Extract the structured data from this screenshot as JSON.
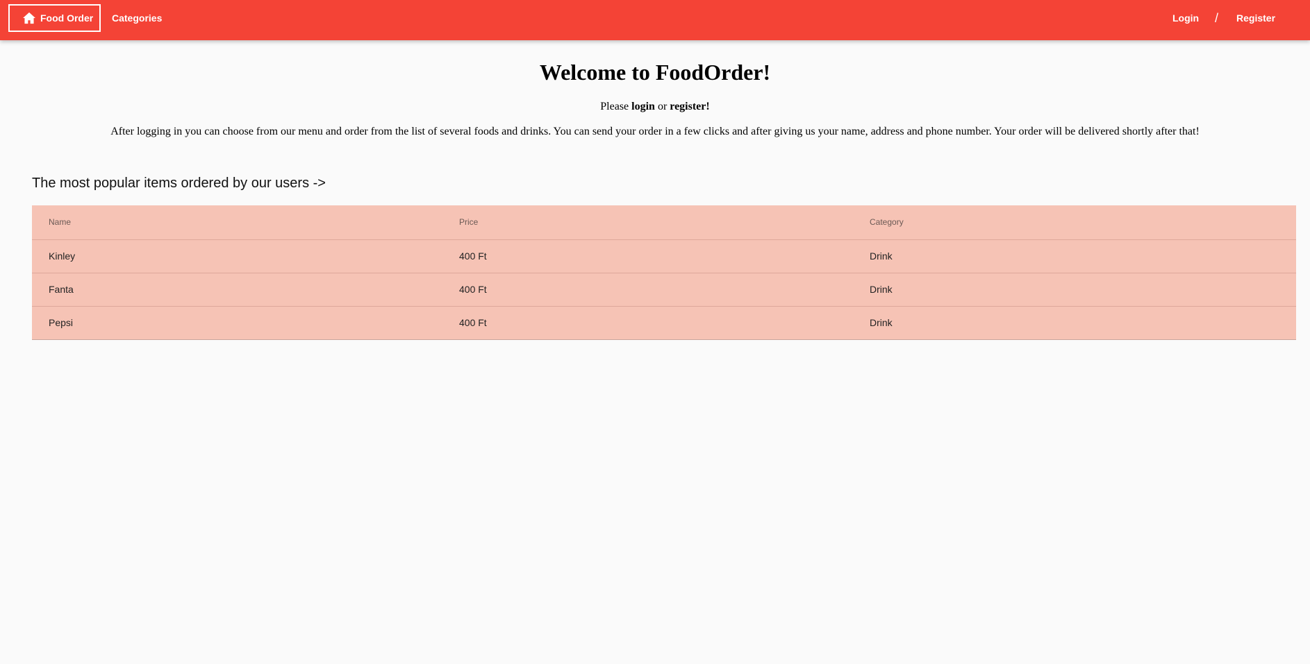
{
  "navbar": {
    "home_label": "Food Order",
    "home_icon": "home-icon",
    "categories_label": "Categories",
    "login_label": "Login",
    "separator": "/",
    "register_label": "Register",
    "color": "#f44336"
  },
  "main": {
    "welcome_title": "Welcome to FoodOrder!",
    "please_prefix": "Please",
    "please_login": "login",
    "please_or": "or",
    "please_register": "register!",
    "description": "After logging in you can choose from our menu and order from the list of several foods and drinks. You can send your order in a few clicks and after giving us your name, address and phone number. Your order will be delivered shortly after that!",
    "popular_title": "The most popular items ordered by our users ->"
  },
  "table": {
    "columns": [
      "Name",
      "Price",
      "Category"
    ],
    "rows": [
      {
        "name": "Kinley",
        "price": "400 Ft",
        "category": "Drink"
      },
      {
        "name": "Fanta",
        "price": "400 Ft",
        "category": "Drink"
      },
      {
        "name": "Pepsi",
        "price": "400 Ft",
        "category": "Drink"
      }
    ],
    "background": "#f6c3b5"
  }
}
